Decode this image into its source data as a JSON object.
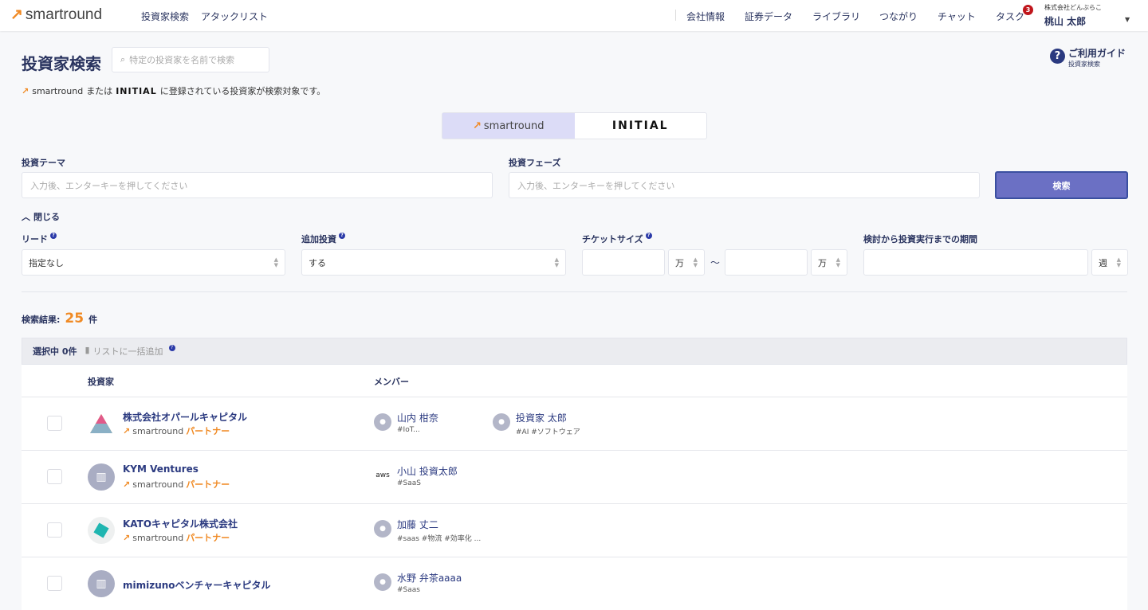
{
  "header": {
    "brand": "smartround",
    "nav": [
      "投資家検索",
      "アタックリスト"
    ],
    "nav_right": [
      "会社情報",
      "証券データ",
      "ライブラリ",
      "つながり",
      "チャット",
      "タスク"
    ],
    "task_badge": "3",
    "company": "株式会社どんぶらこ",
    "user": "桃山 太郎"
  },
  "page": {
    "title": "投資家検索",
    "search_placeholder": "特定の投資家を名前で検索",
    "guide_title": "ご利用ガイド",
    "guide_sub": "投資家検索",
    "notice_brand": "smartround",
    "notice_or": "または",
    "notice_initial": "INITIAL",
    "notice_rest": "に登録されている投資家が検索対象です。"
  },
  "tabs": {
    "smartround": "smartround",
    "initial": "INITIAL"
  },
  "filters": {
    "theme_label": "投資テーマ",
    "theme_placeholder": "入力後、エンターキーを押してください",
    "phase_label": "投資フェーズ",
    "phase_placeholder": "入力後、エンターキーを押してください",
    "search_button": "検索",
    "collapse": "閉じる",
    "lead_label": "リード",
    "lead_value": "指定なし",
    "follow_label": "追加投資",
    "follow_value": "する",
    "ticket_label": "チケットサイズ",
    "unit": "万",
    "tilde": "〜",
    "period_label": "検討から投資実行までの期間",
    "period_unit": "週"
  },
  "results": {
    "label": "検索結果:",
    "count": "25",
    "suffix": "件",
    "selected": "選択中 0件",
    "bulk_add": "リストに一括追加",
    "col_investor": "投資家",
    "col_member": "メンバー",
    "rows": [
      {
        "name": "株式会社オパールキャピタル",
        "partner": true,
        "avatar": "logo-a",
        "members": [
          {
            "name": "山内 柑奈",
            "tags": "#IoT..."
          },
          {
            "name": "投資家 太郎",
            "tags": "#AI #ソフトウェア"
          }
        ]
      },
      {
        "name": "KYM Ventures",
        "partner": true,
        "avatar": "building",
        "members": [
          {
            "name": "小山 投資太郎",
            "tags": "#SaaS",
            "avatar": "aws"
          }
        ]
      },
      {
        "name": "KATOキャピタル株式会社",
        "partner": true,
        "avatar": "kato",
        "members": [
          {
            "name": "加藤 丈二",
            "tags": "#saas #物流 #効率化 ..."
          }
        ]
      },
      {
        "name": "mimizunoベンチャーキャピタル",
        "partner": false,
        "avatar": "building",
        "members": [
          {
            "name": "水野 弁茶aaaa",
            "tags": "#Saas"
          }
        ]
      }
    ],
    "partner_brand": "smartround",
    "partner_label": "パートナー"
  },
  "colors": {
    "navy": "#2b3560",
    "orange": "#f08a24",
    "button": "#6b70c4",
    "tab_active": "#dcdcf7"
  }
}
